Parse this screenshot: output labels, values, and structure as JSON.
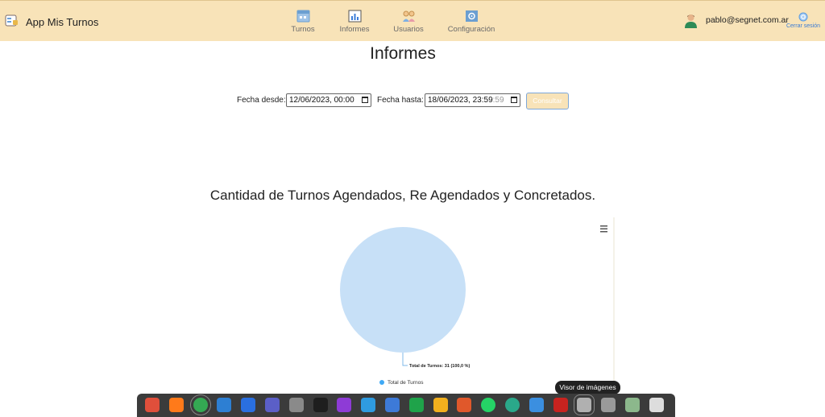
{
  "app": {
    "title": "App Mis Turnos"
  },
  "nav": {
    "items": [
      {
        "label": "Turnos",
        "icon": "calendar-icon"
      },
      {
        "label": "Informes",
        "icon": "bar-chart-icon"
      },
      {
        "label": "Usuarios",
        "icon": "users-icon"
      },
      {
        "label": "Configuración",
        "icon": "gear-icon"
      }
    ]
  },
  "user": {
    "email": "pablo@segnet.com.ar",
    "logout_label": "Cerrar sesión"
  },
  "page": {
    "title": "Informes"
  },
  "filters": {
    "from_label": "Fecha desde:",
    "from_value": "12/06/2023, 00:00",
    "to_label": "Fecha hasta:",
    "to_value": "18/06/2023, 23:59",
    "to_value_seconds": ":59",
    "submit_label": "Consultar"
  },
  "chart_data": {
    "type": "pie",
    "title": "Cantidad de Turnos Agendados, Re Agendados y Concretados.",
    "categories": [
      "Total de Turnos"
    ],
    "values": [
      31
    ],
    "data_labels": [
      "Total de Turnos: 31 (100,0 %)"
    ],
    "legend": [
      "Total de Turnos"
    ],
    "legend_position": "bottom",
    "colors": {
      "slice": "#c7e0f7",
      "legend_marker": "#3fa9f5",
      "connector": "#7fb9ea"
    }
  },
  "taskbar": {
    "tooltip": "Visor de imágenes",
    "apps": [
      {
        "icon": "files-icon",
        "color": "#e04f3b"
      },
      {
        "icon": "firefox-icon",
        "color": "#ff7a1a"
      },
      {
        "icon": "chrome-icon",
        "color": "#34a853"
      },
      {
        "icon": "mail-icon",
        "color": "#2d7fd3"
      },
      {
        "icon": "pycharm-icon",
        "color": "#2a6fe0"
      },
      {
        "icon": "teams-icon",
        "color": "#5b5fc7"
      },
      {
        "icon": "archive-icon",
        "color": "#8a8a8a"
      },
      {
        "icon": "terminal-icon",
        "color": "#1e1e1e"
      },
      {
        "icon": "onenote-icon",
        "color": "#8e3bd6"
      },
      {
        "icon": "vscode-icon",
        "color": "#2f9be0"
      },
      {
        "icon": "writer-icon",
        "color": "#3d7ad8"
      },
      {
        "icon": "calc-icon",
        "color": "#1fa34a"
      },
      {
        "icon": "draw-icon",
        "color": "#f2b01e"
      },
      {
        "icon": "impress-icon",
        "color": "#e0582b"
      },
      {
        "icon": "whatsapp-icon",
        "color": "#25d366"
      },
      {
        "icon": "sync-icon",
        "color": "#2aa88a"
      },
      {
        "icon": "monitor-icon",
        "color": "#3b8fe0"
      },
      {
        "icon": "filezilla-icon",
        "color": "#c8231f"
      },
      {
        "icon": "image-viewer-icon",
        "color": "#b0b0b0"
      },
      {
        "icon": "settings-icon",
        "color": "#9a9a9a"
      },
      {
        "icon": "trash-icon",
        "color": "#8cb88c"
      },
      {
        "icon": "app-grid-icon",
        "color": "#dddddd"
      }
    ]
  }
}
